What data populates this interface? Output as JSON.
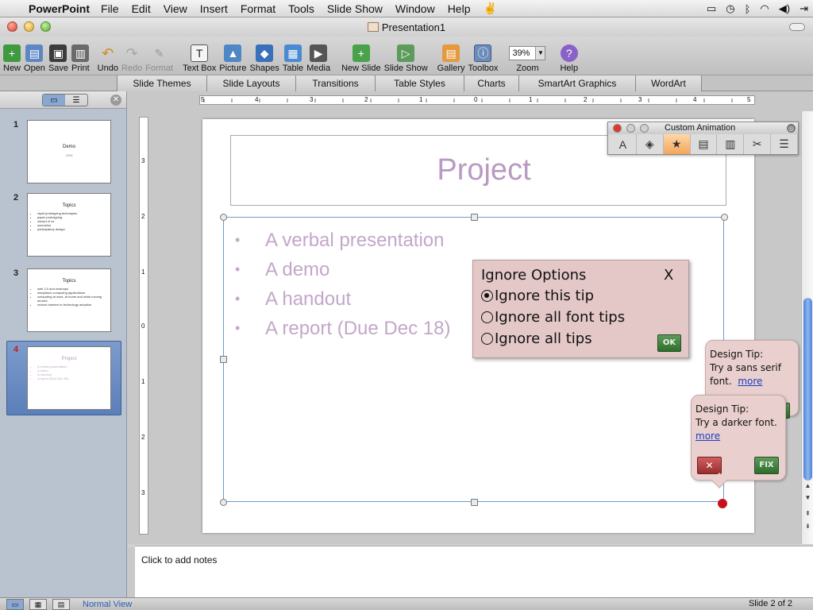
{
  "menubar": {
    "app_name": "PowerPoint",
    "menus": [
      "File",
      "Edit",
      "View",
      "Insert",
      "Format",
      "Tools",
      "Slide Show",
      "Window",
      "Help"
    ]
  },
  "window": {
    "title": "Presentation1"
  },
  "toolbar": {
    "new": "New",
    "open": "Open",
    "save": "Save",
    "print": "Print",
    "undo": "Undo",
    "redo": "Redo",
    "format": "Format",
    "text_box": "Text Box",
    "picture": "Picture",
    "shapes": "Shapes",
    "table": "Table",
    "media": "Media",
    "new_slide": "New Slide",
    "slide_show": "Slide Show",
    "gallery": "Gallery",
    "toolbox": "Toolbox",
    "zoom_label": "Zoom",
    "zoom_value": "39%",
    "help": "Help"
  },
  "ribbon": {
    "tabs": [
      "Slide Themes",
      "Slide Layouts",
      "Transitions",
      "Table Styles",
      "Charts",
      "SmartArt Graphics",
      "WordArt"
    ]
  },
  "slides_pane": {
    "slides": [
      {
        "number": "1",
        "title": "Demo",
        "subtitle": "2008",
        "bullets": []
      },
      {
        "number": "2",
        "title": "Topics",
        "bullets": [
          "rapid prototyping techniques",
          "paper prototyping",
          "wizard of oz",
          "scenarios",
          "participatory design"
        ]
      },
      {
        "number": "3",
        "title": "Topics",
        "bullets": [
          "web 2.0 and mashups",
          "ubiquitous computing applications",
          "computing at work, at home and while moving around",
          "reduce barriers to technology adoption"
        ]
      },
      {
        "number": "4",
        "title": "Project",
        "bullets": [
          "A verbal presentation",
          "A demo",
          "A handout",
          "A report (Due Dec 18)"
        ]
      }
    ]
  },
  "ruler": {
    "horizontal_labels": [
      "5",
      "4",
      "3",
      "2",
      "1",
      "0",
      "1",
      "2",
      "3",
      "4",
      "5"
    ],
    "vertical_labels": [
      "3",
      "2",
      "1",
      "0",
      "1",
      "2",
      "3"
    ]
  },
  "slide": {
    "title": "Project",
    "bullets": [
      "A verbal presentation",
      "A demo",
      "A handout",
      "A report (Due Dec 18)"
    ]
  },
  "custom_animation": {
    "title": "Custom Animation"
  },
  "ignore_options": {
    "heading": "Ignore Options",
    "close": "X",
    "options": [
      "Ignore this tip",
      "Ignore all font tips",
      "Ignore all tips"
    ],
    "selected_index": 0,
    "ok_label": "OK"
  },
  "design_tip_1": {
    "heading": "Design Tip:",
    "text": "Try a sans serif",
    "text2": "font.",
    "more": "more",
    "button": "OK"
  },
  "design_tip_2": {
    "heading": "Design Tip:",
    "text": "Try a darker font.",
    "more": "more",
    "dismiss_label": "✕",
    "fix_label": "FIX"
  },
  "notes": {
    "placeholder": "Click to add notes"
  },
  "statusbar": {
    "view_name": "Normal View",
    "slide_counter": "Slide 2 of 2"
  }
}
